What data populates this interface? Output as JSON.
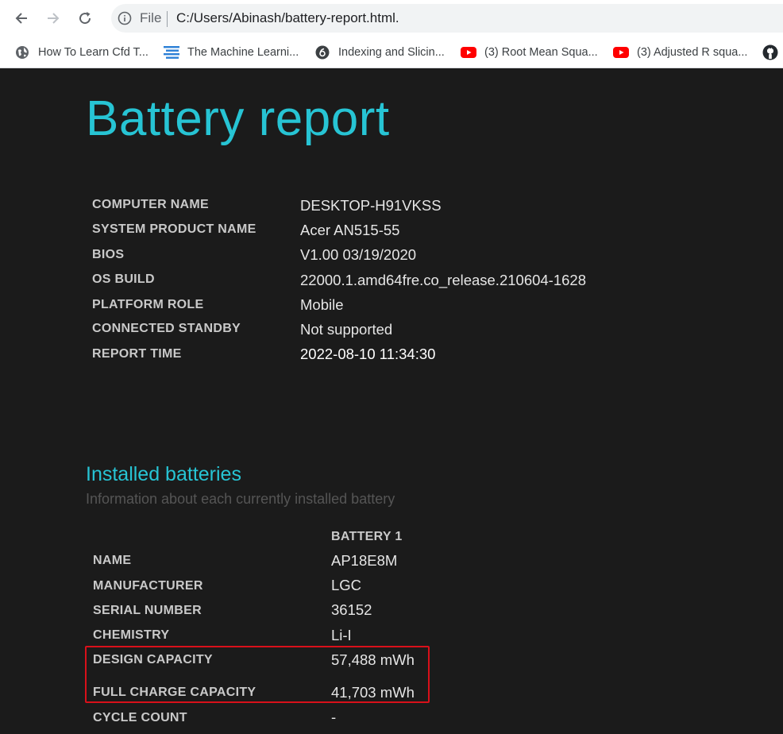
{
  "browser": {
    "file_label": "File",
    "url": "C:/Users/Abinash/battery-report.html."
  },
  "bookmarks": [
    {
      "label": "How To Learn Cfd T...",
      "icon": "globe-icon"
    },
    {
      "label": "The Machine Learni...",
      "icon": "lines-icon"
    },
    {
      "label": "Indexing and Slicin...",
      "icon": "circle-6-icon"
    },
    {
      "label": "(3) Root Mean Squa...",
      "icon": "youtube-icon"
    },
    {
      "label": "(3) Adjusted R squa...",
      "icon": "youtube-icon"
    }
  ],
  "report": {
    "title": "Battery report",
    "system_info": [
      {
        "label": "COMPUTER NAME",
        "value": "DESKTOP-H91VKSS"
      },
      {
        "label": "SYSTEM PRODUCT NAME",
        "value": "Acer AN515-55"
      },
      {
        "label": "BIOS",
        "value": "V1.00 03/19/2020"
      },
      {
        "label": "OS BUILD",
        "value": "22000.1.amd64fre.co_release.210604-1628"
      },
      {
        "label": "PLATFORM ROLE",
        "value": "Mobile"
      },
      {
        "label": "CONNECTED STANDBY",
        "value": "Not supported"
      },
      {
        "label": "REPORT TIME",
        "value": "2022-08-10  11:34:30"
      }
    ],
    "installed": {
      "title": "Installed batteries",
      "subtitle": "Information about each currently installed battery",
      "column": "BATTERY 1",
      "rows": [
        {
          "label": "NAME",
          "value": "AP18E8M"
        },
        {
          "label": "MANUFACTURER",
          "value": "LGC"
        },
        {
          "label": "SERIAL NUMBER",
          "value": "36152"
        },
        {
          "label": "CHEMISTRY",
          "value": "Li-I"
        },
        {
          "label": "DESIGN CAPACITY",
          "value": "57,488 mWh"
        },
        {
          "label": "FULL CHARGE CAPACITY",
          "value": "41,703 mWh"
        },
        {
          "label": "CYCLE COUNT",
          "value": "-"
        }
      ]
    }
  },
  "colors": {
    "accent": "#27c4d4",
    "background": "#1b1b1b",
    "highlight": "#d9101a"
  }
}
